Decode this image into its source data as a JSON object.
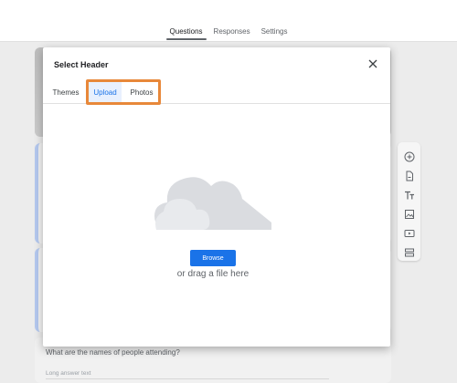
{
  "form_tabs": [
    {
      "label": "Questions",
      "active": true
    },
    {
      "label": "Responses",
      "active": false
    },
    {
      "label": "Settings",
      "active": false
    }
  ],
  "background": {
    "question_text": "What are the names of people attending?",
    "answer_placeholder": "Long answer text"
  },
  "side_toolbar": {
    "tools": [
      "add-question-icon",
      "import-questions-icon",
      "add-title-icon",
      "add-image-icon",
      "add-video-icon",
      "add-section-icon"
    ]
  },
  "modal": {
    "title": "Select Header",
    "tabs": [
      {
        "label": "Themes",
        "active": false
      },
      {
        "label": "Upload",
        "active": true
      },
      {
        "label": "Photos",
        "active": false
      }
    ],
    "browse_label": "Browse",
    "drag_text": "or drag a file here",
    "close_icon": "close-icon",
    "upload_icon": "cloud-icon"
  },
  "colors": {
    "accent": "#1a73e8",
    "highlight": "#e8883a",
    "accent_tint": "#e8f0fe"
  }
}
